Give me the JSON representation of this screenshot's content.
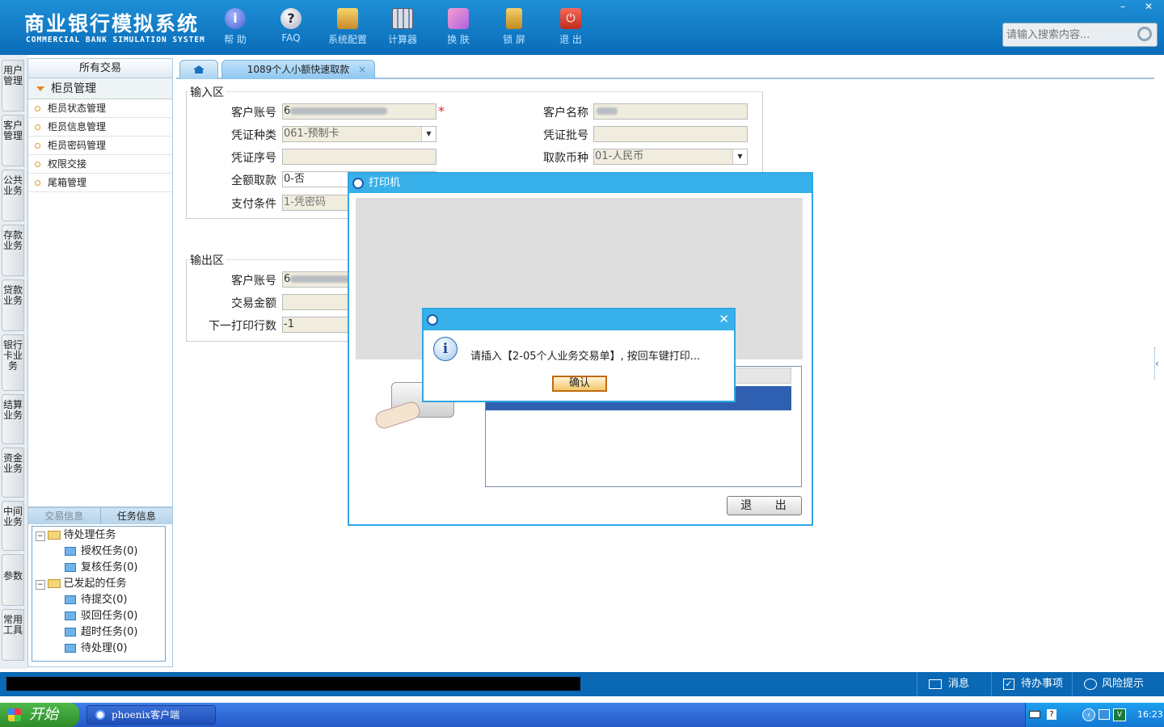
{
  "app": {
    "title_cn": "商业银行模拟系统",
    "title_en": "COMMERCIAL BANK SIMULATION SYSTEM"
  },
  "toolbar": {
    "help": "帮 助",
    "faq": "FAQ",
    "config": "系统配置",
    "calculator": "计算器",
    "skin": "换 肤",
    "lock": "锁 屏",
    "exit": "退 出"
  },
  "window_controls": {
    "minimize": "–",
    "close": "✕"
  },
  "search": {
    "placeholder": "请输入搜索内容..."
  },
  "left_tabs": [
    "用户管理",
    "客户管理",
    "公共业务",
    "存款业务",
    "贷款业务",
    "银行卡业务",
    "结算业务",
    "资金业务",
    "中间业务",
    "参数",
    "常用工具"
  ],
  "sidebar": {
    "header": "所有交易",
    "group": "柜员管理",
    "items": [
      "柜员状态管理",
      "柜员信息管理",
      "柜员密码管理",
      "权限交接",
      "尾箱管理"
    ]
  },
  "task_panel": {
    "tabs": [
      "交易信息",
      "任务信息"
    ],
    "pending": "待处理任务",
    "auth": "授权任务(0)",
    "review": "复核任务(0)",
    "initiated": "已发起的任务",
    "to_submit": "待提交(0)",
    "rejected": "驳回任务(0)",
    "timeout": "超时任务(0)",
    "processing": "待处理(0)"
  },
  "tabs": {
    "active": "1089个人小额快速取款",
    "close": "×"
  },
  "input_area": {
    "legend": "输入区",
    "account_label": "客户账号",
    "account_prefix": "6",
    "required_mark": "*",
    "name_label": "客户名称",
    "voucher_type_label": "凭证种类",
    "voucher_type_value": "061-预制卡",
    "voucher_batch_label": "凭证批号",
    "voucher_seq_label": "凭证序号",
    "currency_label": "取款币种",
    "currency_value": "01-人民币",
    "full_label": "全额取款",
    "full_value": "0-否",
    "pay_label": "支付条件",
    "pay_value": "1-凭密码"
  },
  "output_area": {
    "legend": "输出区",
    "account_label": "客户账号",
    "account_prefix": "6",
    "amount_label": "交易金额",
    "next_line_label": "下一打印行数",
    "next_line_value": "-1"
  },
  "printer_dialog": {
    "title": "打印机",
    "exit": "退 出"
  },
  "message_dialog": {
    "text": "请插入【2-05个人业务交易单】, 按回车键打印...",
    "ok": "确认",
    "close": "✕"
  },
  "status_bar": {
    "message": "消息",
    "todo": "待办事项",
    "risk": "风险提示"
  },
  "taskbar": {
    "start": "开始",
    "app": "phoenix客户端",
    "time": "16:23"
  },
  "colors": {
    "header": "#0a6cb8",
    "dialog_title": "#38b0ea",
    "ok_border": "#c06b10"
  }
}
